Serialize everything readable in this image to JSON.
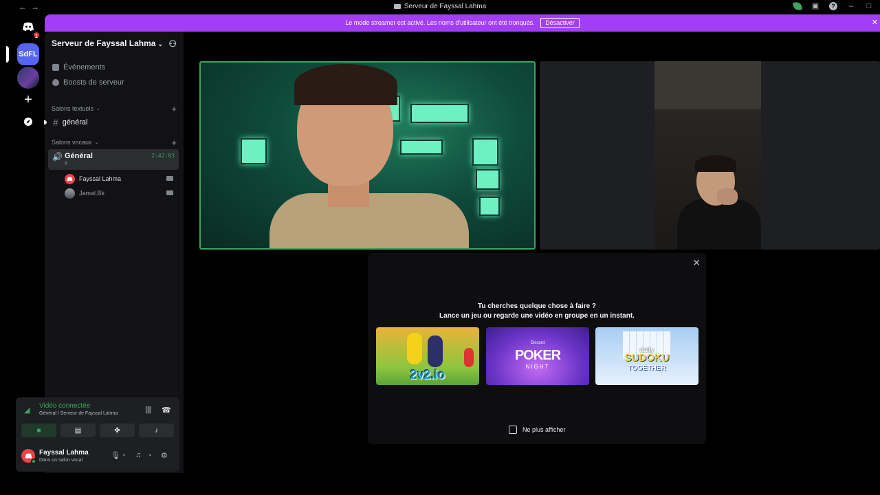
{
  "window": {
    "title": "Serveur de Fayssal Lahma",
    "nav_back": "←",
    "nav_forward": "→"
  },
  "banner": {
    "text": "Le mode streamer est activé. Les noms d'utilisateur ont été tronqués.",
    "button": "Désactiver"
  },
  "rail": {
    "home_badge": "1",
    "server_abbrev": "SdFL"
  },
  "sidebar": {
    "server_name": "Serveur de Fayssal Lahma",
    "links": [
      "Événements",
      "Boosts de serveur"
    ],
    "text_category": "Salons textuels",
    "text_channels": [
      "général"
    ],
    "voice_category": "Salons vocaux",
    "voice_channel": {
      "name": "Général",
      "sub": "ff",
      "timer": "2:42:03"
    },
    "voice_users": [
      {
        "name": "Fayssal Lahma"
      },
      {
        "name": "Jamal.Bk"
      }
    ]
  },
  "voice_panel": {
    "status": "Vidéo connectée",
    "location": "Général / Serveur de Fayssal Lahma"
  },
  "user_bar": {
    "name": "Fayssal Lahma",
    "status": "Dans un salon vocal"
  },
  "activity_popup": {
    "line1": "Tu cherches quelque chose à faire ?",
    "line2": "Lance un jeu ou regarde une vidéo en groupe en un instant.",
    "cards": [
      {
        "title": "2v2.io"
      },
      {
        "brand": "Discord",
        "title": "POKER",
        "subtitle": "NIGHT"
      },
      {
        "pre": "daily",
        "title": "SUDOKU",
        "subtitle": "TOGETHER"
      }
    ],
    "checkbox_label": "Ne plus afficher"
  },
  "colors": {
    "accent_purple": "#a23ff6",
    "connected_green": "#3ba55d",
    "blurple": "#5865f2"
  }
}
